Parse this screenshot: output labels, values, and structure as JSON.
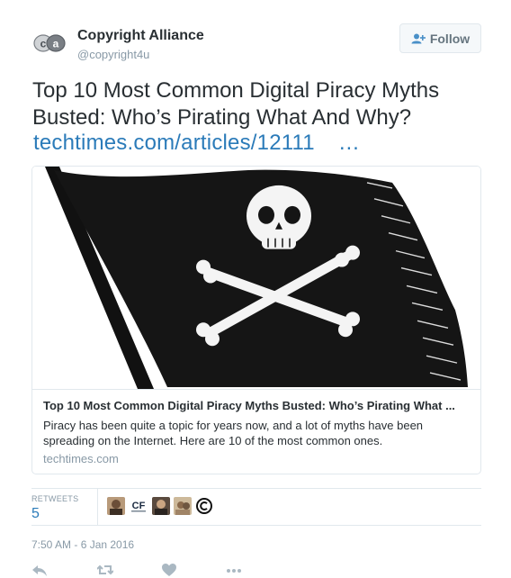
{
  "author": {
    "name": "Copyright Alliance",
    "handle": "@copyright4u",
    "avatar_icon": "copyright-alliance-logo"
  },
  "follow_button": {
    "label": "Follow",
    "icon": "add-user-icon"
  },
  "tweet": {
    "text": "Top 10 Most Common Digital Piracy Myths Busted: Who’s Pirating What And Why?",
    "link_text": "techtimes.com/articles/12111",
    "link_ellipsis": "…"
  },
  "card": {
    "image": "pirate-flag-illustration",
    "title": "Top 10 Most Common Digital Piracy Myths Busted: Who’s Pirating What ...",
    "description": "Piracy has been quite a topic for years now, and a lot of myths have been spreading on the Internet. Here are 10 of the most common ones.",
    "domain": "techtimes.com"
  },
  "stats": {
    "retweets_label": "RETWEETS",
    "retweets_count": "5",
    "retweeter_avatars": [
      "avatar-1",
      "avatar-cf",
      "avatar-3",
      "avatar-4",
      "avatar-copyright"
    ],
    "cf_label": "CF"
  },
  "timestamp": "7:50 AM - 6 Jan 2016",
  "actions": [
    "reply-icon",
    "retweet-icon",
    "like-icon",
    "more-icon"
  ],
  "colors": {
    "link": "#2b7bb9",
    "muted": "#8899a6",
    "text": "#292f33",
    "border": "#e1e8ed"
  }
}
